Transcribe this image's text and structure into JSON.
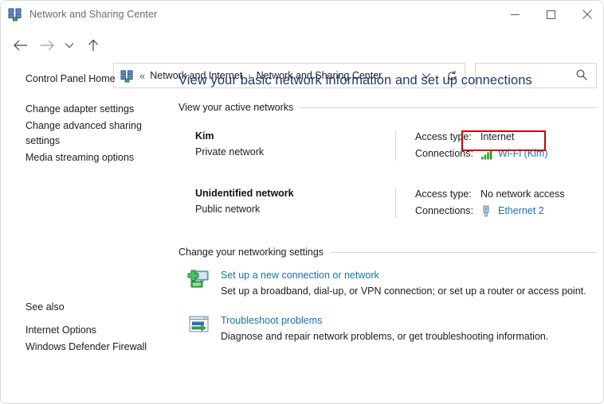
{
  "window": {
    "title": "Network and Sharing Center",
    "icon": "network-sharing-center-icon",
    "controls": {
      "minimize": "Minimize",
      "maximize": "Maximize",
      "close": "Close"
    }
  },
  "nav": {
    "back": "Back",
    "forward": "Forward",
    "recent": "Recent locations",
    "up": "Up one level",
    "address_overflow": "«",
    "breadcrumbs": [
      {
        "label": "Network and Internet"
      },
      {
        "label": "Network and Sharing Center"
      }
    ],
    "breadcrumb_separator": "›",
    "dropdown": "Previous locations",
    "refresh": "Refresh"
  },
  "search": {
    "value": "",
    "placeholder": "",
    "icon": "search-icon"
  },
  "sidebar": {
    "home": "Control Panel Home",
    "items": [
      {
        "label": "Change adapter settings"
      },
      {
        "label": "Change advanced sharing\nsettings"
      },
      {
        "label": "Media streaming options"
      }
    ],
    "see_also": {
      "title": "See also",
      "items": [
        {
          "label": "Internet Options"
        },
        {
          "label": "Windows Defender Firewall"
        }
      ]
    }
  },
  "main": {
    "page_title": "View your basic network information and set up connections",
    "active_networks_heading": "View your active networks",
    "networks": [
      {
        "name": "Kim",
        "type": "Private network",
        "access_key": "Access type:",
        "access_value": "Internet",
        "connections_key": "Connections:",
        "connection_label": "Wi-Fi (Kim)",
        "connection_icon": "wifi-signal-icon",
        "highlighted": true
      },
      {
        "name": "Unidentified network",
        "type": "Public network",
        "access_key": "Access type:",
        "access_value": "No network access",
        "connections_key": "Connections:",
        "connection_label": "Ethernet 2",
        "connection_icon": "ethernet-plug-icon",
        "highlighted": false
      }
    ],
    "change_settings_heading": "Change your networking settings",
    "settings": [
      {
        "icon": "new-connection-icon",
        "title": "Set up a new connection or network",
        "description": "Set up a broadband, dial-up, or VPN connection; or set up a router or access point."
      },
      {
        "icon": "troubleshoot-icon",
        "title": "Troubleshoot problems",
        "description": "Diagnose and repair network problems, or get troubleshooting information."
      }
    ]
  },
  "colors": {
    "heading": "#1f3864",
    "link": "#1a6fb5",
    "highlight": "#cc0000",
    "wifi_green": "#2e9c3a",
    "rule": "#d4d4d4"
  }
}
